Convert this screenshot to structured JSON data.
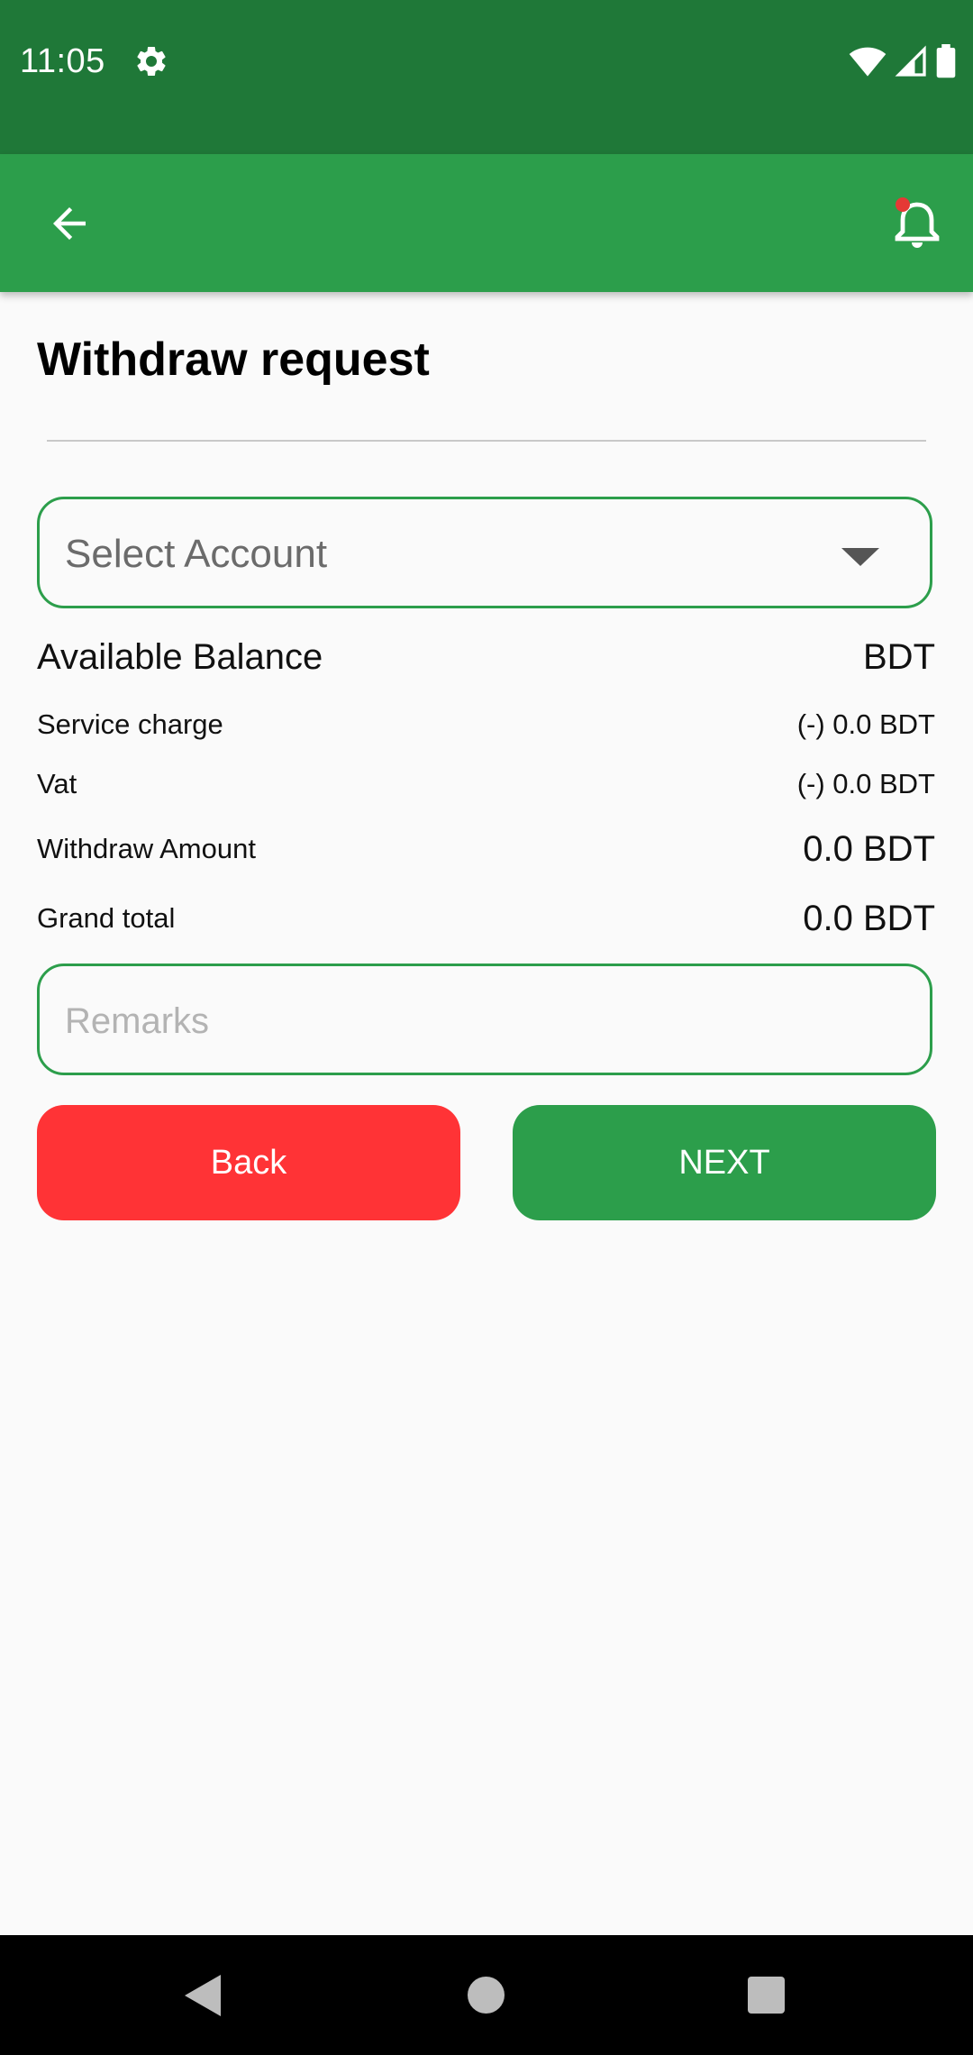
{
  "status_bar": {
    "time": "11:05",
    "icons": [
      "gear-icon",
      "wifi-icon",
      "cell-signal-icon",
      "battery-icon"
    ]
  },
  "app_bar": {
    "background": "#2c9e4b",
    "icons": [
      "back-arrow-icon",
      "bell-icon"
    ],
    "notification_dot_color": "#e53935"
  },
  "page": {
    "title": "Withdraw request"
  },
  "form": {
    "account_select": {
      "placeholder": "Select Account",
      "icon": "caret-down-icon"
    },
    "available_balance": {
      "label": "Available Balance",
      "value": "BDT"
    },
    "service_charge": {
      "label": "Service charge",
      "value": "(-) 0.0 BDT"
    },
    "vat": {
      "label": "Vat",
      "value": "(-) 0.0 BDT"
    },
    "withdraw_amount": {
      "label": "Withdraw Amount",
      "value": "0.0 BDT"
    },
    "grand_total": {
      "label": "Grand total",
      "value": "0.0 BDT"
    },
    "remarks": {
      "placeholder": "Remarks",
      "value": ""
    }
  },
  "buttons": {
    "back": {
      "label": "Back",
      "color": "#ff3336"
    },
    "next": {
      "label": "NEXT",
      "color": "#2c9e4b"
    }
  },
  "nav_bar": {
    "icons": [
      "nav-back-icon",
      "nav-home-icon",
      "nav-recents-icon"
    ]
  }
}
